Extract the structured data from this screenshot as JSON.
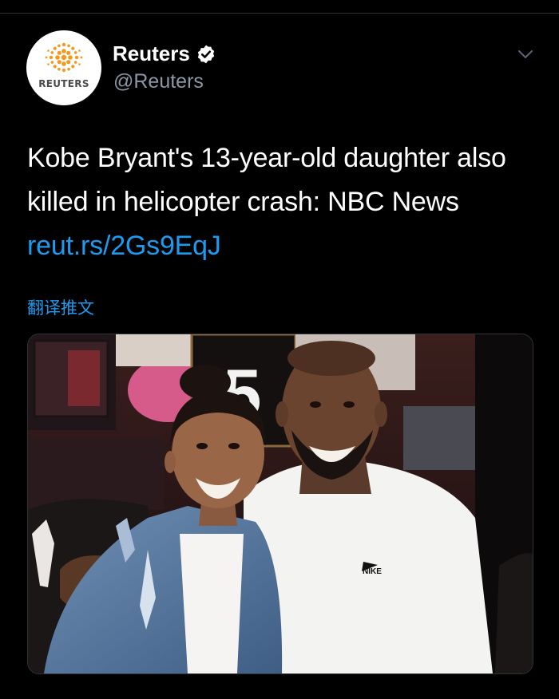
{
  "tweet": {
    "author": {
      "name": "Reuters",
      "handle": "@Reuters",
      "verified": true,
      "avatar_text": "REUTERS",
      "avatar_icon": "reuters-dot-logo"
    },
    "text": "Kobe Bryant's 13-year-old daughter also killed in helicopter crash: NBC News",
    "link": "reut.rs/2Gs9EqJ",
    "translate_label": "翻译推文",
    "media": {
      "jersey_number": "5",
      "shirt_logo": "NIKE"
    }
  },
  "icons": {
    "verified": "verified-check-icon",
    "menu": "chevron-down-icon"
  },
  "colors": {
    "background": "#000000",
    "text": "#ffffff",
    "secondary_text": "#8b98a5",
    "link": "#1d9bf0",
    "reuters_orange": "#f39a1e"
  }
}
